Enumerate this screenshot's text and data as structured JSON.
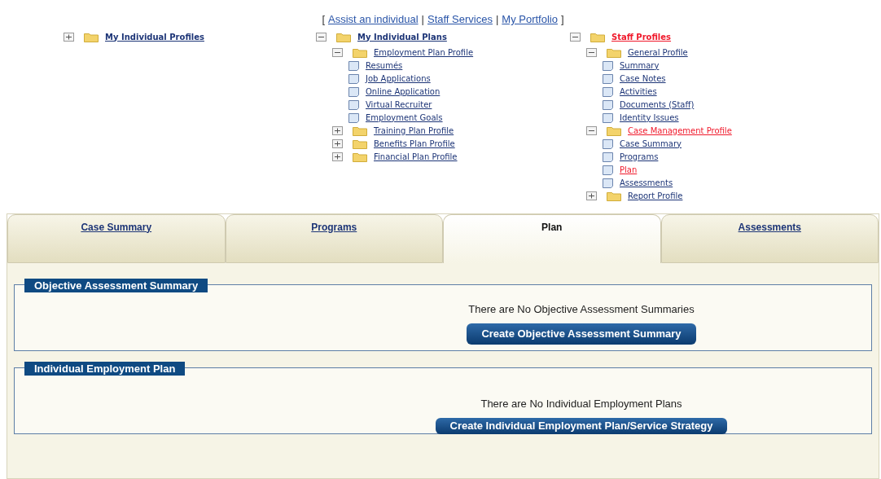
{
  "top_nav": {
    "open_bracket": "[",
    "separator": "|",
    "close_bracket": "]",
    "links": [
      "Assist an individual",
      "Staff Services",
      "My Portfolio"
    ]
  },
  "trees": [
    {
      "label": "My Individual Profiles",
      "kind": "folder",
      "expanded": false,
      "active": false
    },
    {
      "label": "My Individual Plans",
      "kind": "folder",
      "expanded": true,
      "active": false,
      "children": [
        {
          "label": "Employment Plan Profile",
          "kind": "folder",
          "expanded": true,
          "active": false,
          "children": [
            {
              "label": "Resumés",
              "kind": "page",
              "active": false
            },
            {
              "label": "Job Applications",
              "kind": "page",
              "active": false
            },
            {
              "label": "Online Application",
              "kind": "page",
              "active": false
            },
            {
              "label": "Virtual Recruiter",
              "kind": "page",
              "active": false
            },
            {
              "label": "Employment Goals",
              "kind": "page",
              "active": false
            }
          ]
        },
        {
          "label": "Training Plan Profile",
          "kind": "folder",
          "expanded": false,
          "active": false
        },
        {
          "label": "Benefits Plan Profile",
          "kind": "folder",
          "expanded": false,
          "active": false
        },
        {
          "label": "Financial Plan Profile",
          "kind": "folder",
          "expanded": false,
          "active": false
        }
      ]
    },
    {
      "label": "Staff Profiles",
      "kind": "folder",
      "expanded": true,
      "active": true,
      "children": [
        {
          "label": "General Profile",
          "kind": "folder",
          "expanded": true,
          "active": false,
          "children": [
            {
              "label": "Summary",
              "kind": "page",
              "active": false
            },
            {
              "label": "Case Notes",
              "kind": "page",
              "active": false
            },
            {
              "label": "Activities",
              "kind": "page",
              "active": false
            },
            {
              "label": "Documents (Staff)",
              "kind": "page",
              "active": false
            },
            {
              "label": "Identity Issues",
              "kind": "page",
              "active": false
            }
          ]
        },
        {
          "label": "Case Management Profile",
          "kind": "folder",
          "expanded": true,
          "active": true,
          "children": [
            {
              "label": "Case Summary",
              "kind": "page",
              "active": false
            },
            {
              "label": "Programs",
              "kind": "page",
              "active": false
            },
            {
              "label": "Plan",
              "kind": "page",
              "active": true
            },
            {
              "label": "Assessments",
              "kind": "page",
              "active": false
            }
          ]
        },
        {
          "label": "Report Profile",
          "kind": "folder",
          "expanded": false,
          "active": false
        }
      ]
    }
  ],
  "tabs": [
    {
      "label": "Case Summary",
      "selected": false
    },
    {
      "label": "Programs",
      "selected": false
    },
    {
      "label": "Plan",
      "selected": true
    },
    {
      "label": "Assessments",
      "selected": false
    }
  ],
  "sections": [
    {
      "title": "Objective Assessment Summary",
      "message": "There are No Objective Assessment Summaries",
      "button": "Create Objective Assessment Summary"
    },
    {
      "title": "Individual Employment Plan",
      "message": "There are No Individual Employment Plans",
      "button": "Create Individual Employment Plan/Service Strategy"
    }
  ]
}
